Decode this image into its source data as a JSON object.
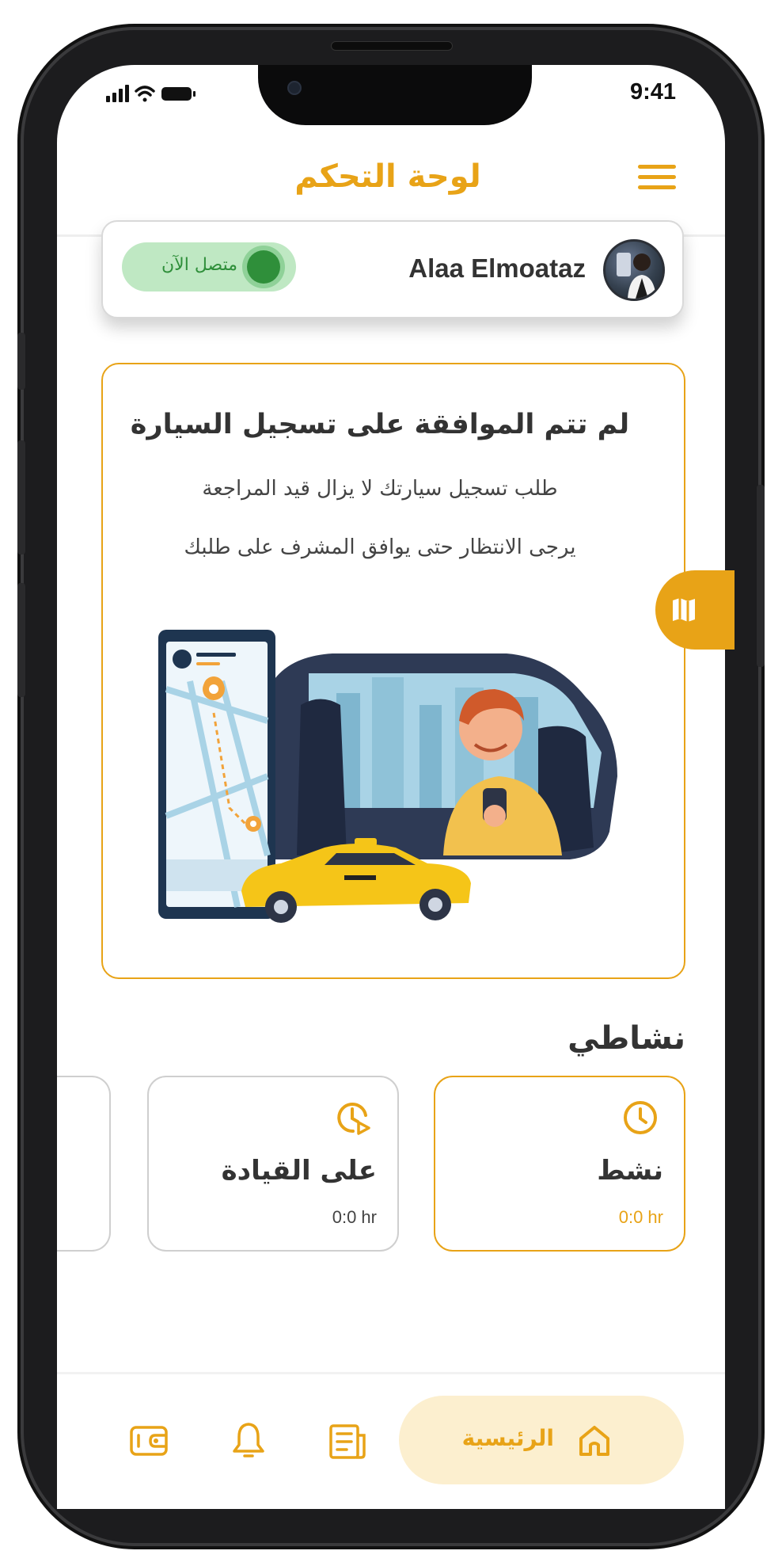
{
  "status_bar": {
    "time": "9:41",
    "icons": [
      "signal-icon",
      "wifi-icon",
      "battery-icon"
    ]
  },
  "header": {
    "title": "لوحة التحكم",
    "menu_icon": "hamburger-menu-icon"
  },
  "profile": {
    "name": "Alaa Elmoataz",
    "status_label": "متصل الآن",
    "online": true
  },
  "notice": {
    "title": "لم تتم الموافقة على تسجيل السيارة",
    "line1": "طلب تسجيل سيارتك لا يزال قيد المراجعة",
    "line2": "يرجى الانتظار حتى يوافق المشرف على طلبك"
  },
  "activity": {
    "title": "نشاطي",
    "cards": [
      {
        "name": "نشط",
        "value": "0:0 hr",
        "icon": "clock-icon",
        "selected": true
      },
      {
        "name": "على القيادة",
        "value": "0:0 hr",
        "icon": "clock-play-icon",
        "selected": false
      }
    ]
  },
  "nav": {
    "home_label": "الرئيسية",
    "items": [
      "home-icon",
      "news-icon",
      "bell-icon",
      "wallet-icon"
    ]
  },
  "colors": {
    "accent": "#E8A317",
    "accent_light": "#FCEFCF",
    "online_green": "#2f8f3a",
    "online_bg": "#bfe8c3",
    "text_dark": "#333333"
  }
}
